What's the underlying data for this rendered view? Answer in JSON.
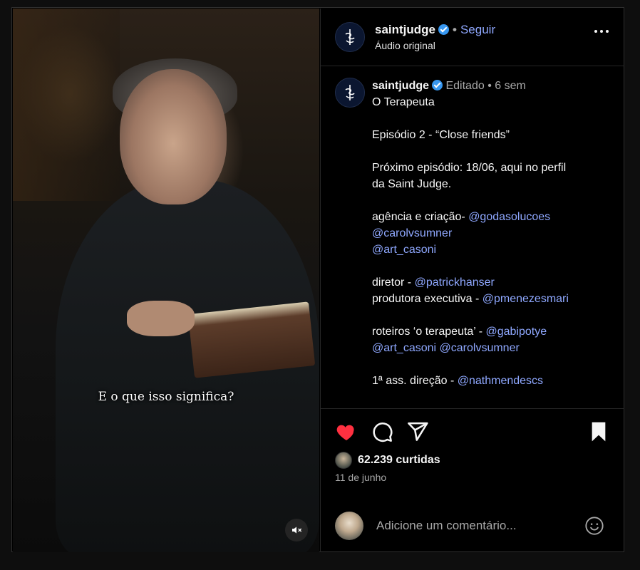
{
  "video": {
    "subtitle": "E o que isso significa?",
    "mute_icon": "speaker-muted-icon"
  },
  "header": {
    "username": "saintjudge",
    "separator": "•",
    "follow_label": "Seguir",
    "audio_label": "Áudio original",
    "more_icon": "more-options-icon"
  },
  "caption": {
    "username": "saintjudge",
    "edited_label": "Editado",
    "separator": "•",
    "age": "6 sem",
    "title": "O Terapeuta",
    "episode": "Episódio 2 - “Close friends”",
    "next_1": "Próximo episódio: 18/06, aqui no perfil",
    "next_2": "da Saint Judge.",
    "agency_label": "agência e criação- ",
    "agency_m1": "@godasolucoes",
    "agency_m2": "@carolvsumner",
    "agency_m3": "@art_casoni",
    "director_label": "diretor - ",
    "director_m": "@patrickhanser",
    "producer_label": "produtora executiva - ",
    "producer_m": "@pmenezesmari",
    "scripts_label": "roteiros ‘o terapeuta’ - ",
    "scripts_m1": "@gabipotye",
    "scripts_m2": "@art_casoni",
    "scripts_m3": "@carolvsumner",
    "assist_label": "1ª ass. direção - ",
    "assist_m": "@nathmendescs"
  },
  "actions": {
    "like_icon": "heart-filled-icon",
    "comment_icon": "comment-icon",
    "share_icon": "send-icon",
    "save_icon": "bookmark-filled-icon",
    "like_color": "#ff3040"
  },
  "likes": {
    "text": "62.239 curtidas"
  },
  "date": "11 de junho",
  "comment": {
    "placeholder": "Adicione um comentário...",
    "emoji_icon": "emoji-smile-icon"
  }
}
